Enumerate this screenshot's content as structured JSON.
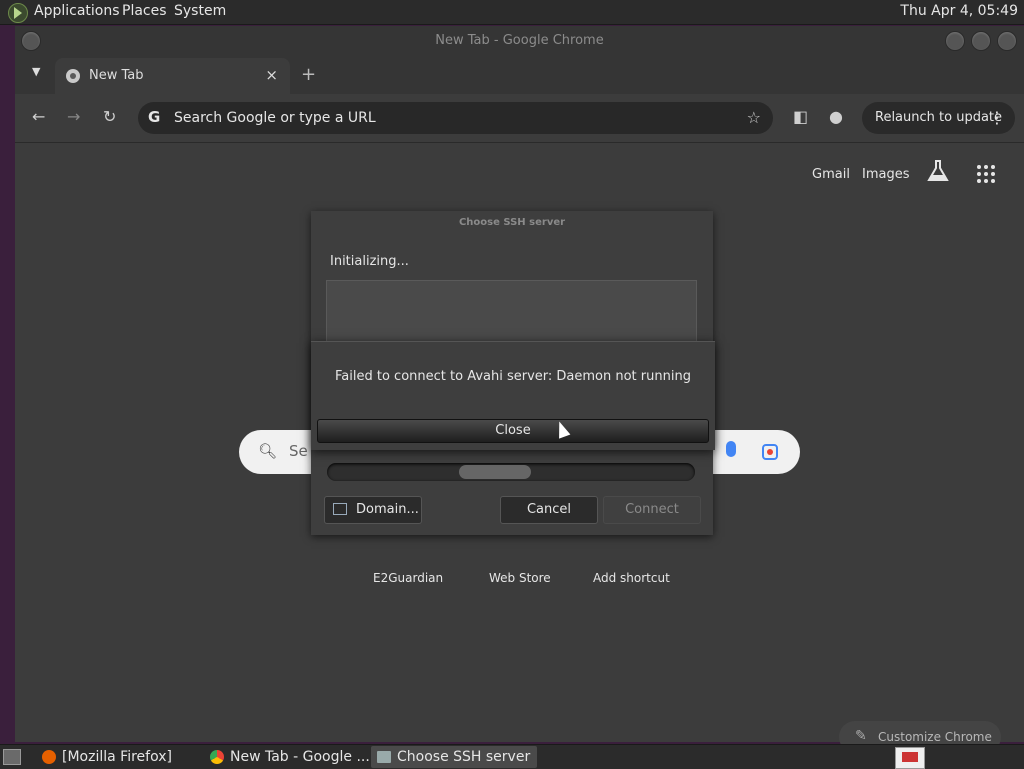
{
  "top_panel": {
    "menus": [
      "Applications",
      "Places",
      "System"
    ],
    "clock": "Thu Apr  4, 05:49"
  },
  "chrome": {
    "window_title": "New Tab - Google Chrome",
    "tab": {
      "title": "New Tab",
      "close": "×"
    },
    "new_tab": "+",
    "toolbar": {
      "omnibox_placeholder": "Search Google or type a URL",
      "relaunch_label": "Relaunch to update"
    },
    "ntp": {
      "links": [
        "Gmail",
        "Images"
      ],
      "search_text": "Se",
      "shortcuts": [
        "E2Guardian",
        "Web Store",
        "Add shortcut"
      ],
      "customize_label": "Customize Chrome"
    }
  },
  "ssh_dialog": {
    "title": "Choose SSH server",
    "status": "Initializing...",
    "buttons": {
      "domain": "Domain...",
      "cancel": "Cancel",
      "connect": "Connect"
    }
  },
  "error_dialog": {
    "message": "Failed to connect to Avahi server: Daemon not running",
    "close_label": "Close"
  },
  "taskbar": {
    "tasks": [
      {
        "label": "[Mozilla Firefox]",
        "icon": "firefox-icon"
      },
      {
        "label": "New Tab - Google ...",
        "icon": "chrome-icon"
      },
      {
        "label": "Choose SSH server",
        "icon": "window-icon"
      }
    ]
  },
  "colors": {
    "chrome_bg": "#3c3c3c",
    "panel_bg": "#2b2b2b",
    "google_blue": "#4285f4"
  }
}
